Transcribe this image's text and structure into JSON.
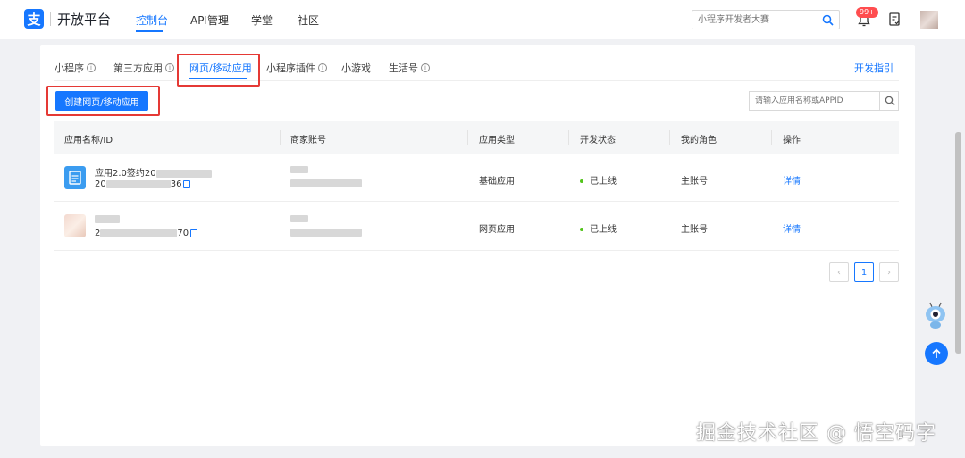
{
  "topnav": {
    "brand": "开放平台",
    "logo_char": "支",
    "items": [
      {
        "label": "控制台",
        "active": true
      },
      {
        "label": "API管理",
        "active": false
      },
      {
        "label": "学堂",
        "active": false
      },
      {
        "label": "社区",
        "active": false
      }
    ],
    "search_placeholder": "小程序开发者大赛",
    "notification_badge": "99+"
  },
  "tabs": [
    {
      "label": "小程序",
      "info": true,
      "active": false
    },
    {
      "label": "第三方应用",
      "info": true,
      "active": false
    },
    {
      "label": "网页/移动应用",
      "info": false,
      "active": true
    },
    {
      "label": "小程序插件",
      "info": true,
      "active": false
    },
    {
      "label": "小游戏",
      "info": false,
      "active": false
    },
    {
      "label": "生活号",
      "info": true,
      "active": false
    }
  ],
  "guide_link": "开发指引",
  "create_button": "创建网页/移动应用",
  "app_search_placeholder": "请输入应用名称或APPID",
  "table": {
    "headers": [
      "应用名称/ID",
      "商家账号",
      "应用类型",
      "开发状态",
      "我的角色",
      "操作"
    ],
    "rows": [
      {
        "name": "应用2.0签约20",
        "id_prefix": "20",
        "id_suffix": "36",
        "type": "基础应用",
        "status": "已上线",
        "role": "主账号",
        "action": "详情"
      },
      {
        "name": "",
        "id_prefix": "2",
        "id_suffix": "70",
        "type": "网页应用",
        "status": "已上线",
        "role": "主账号",
        "action": "详情"
      }
    ]
  },
  "pagination": {
    "current": "1",
    "prev": "‹",
    "next": "›"
  },
  "watermark": "掘金技术社区 @ 悟空码字",
  "colors": {
    "accent": "#1677ff",
    "highlight": "#e53935",
    "status_online": "#52c41a"
  }
}
